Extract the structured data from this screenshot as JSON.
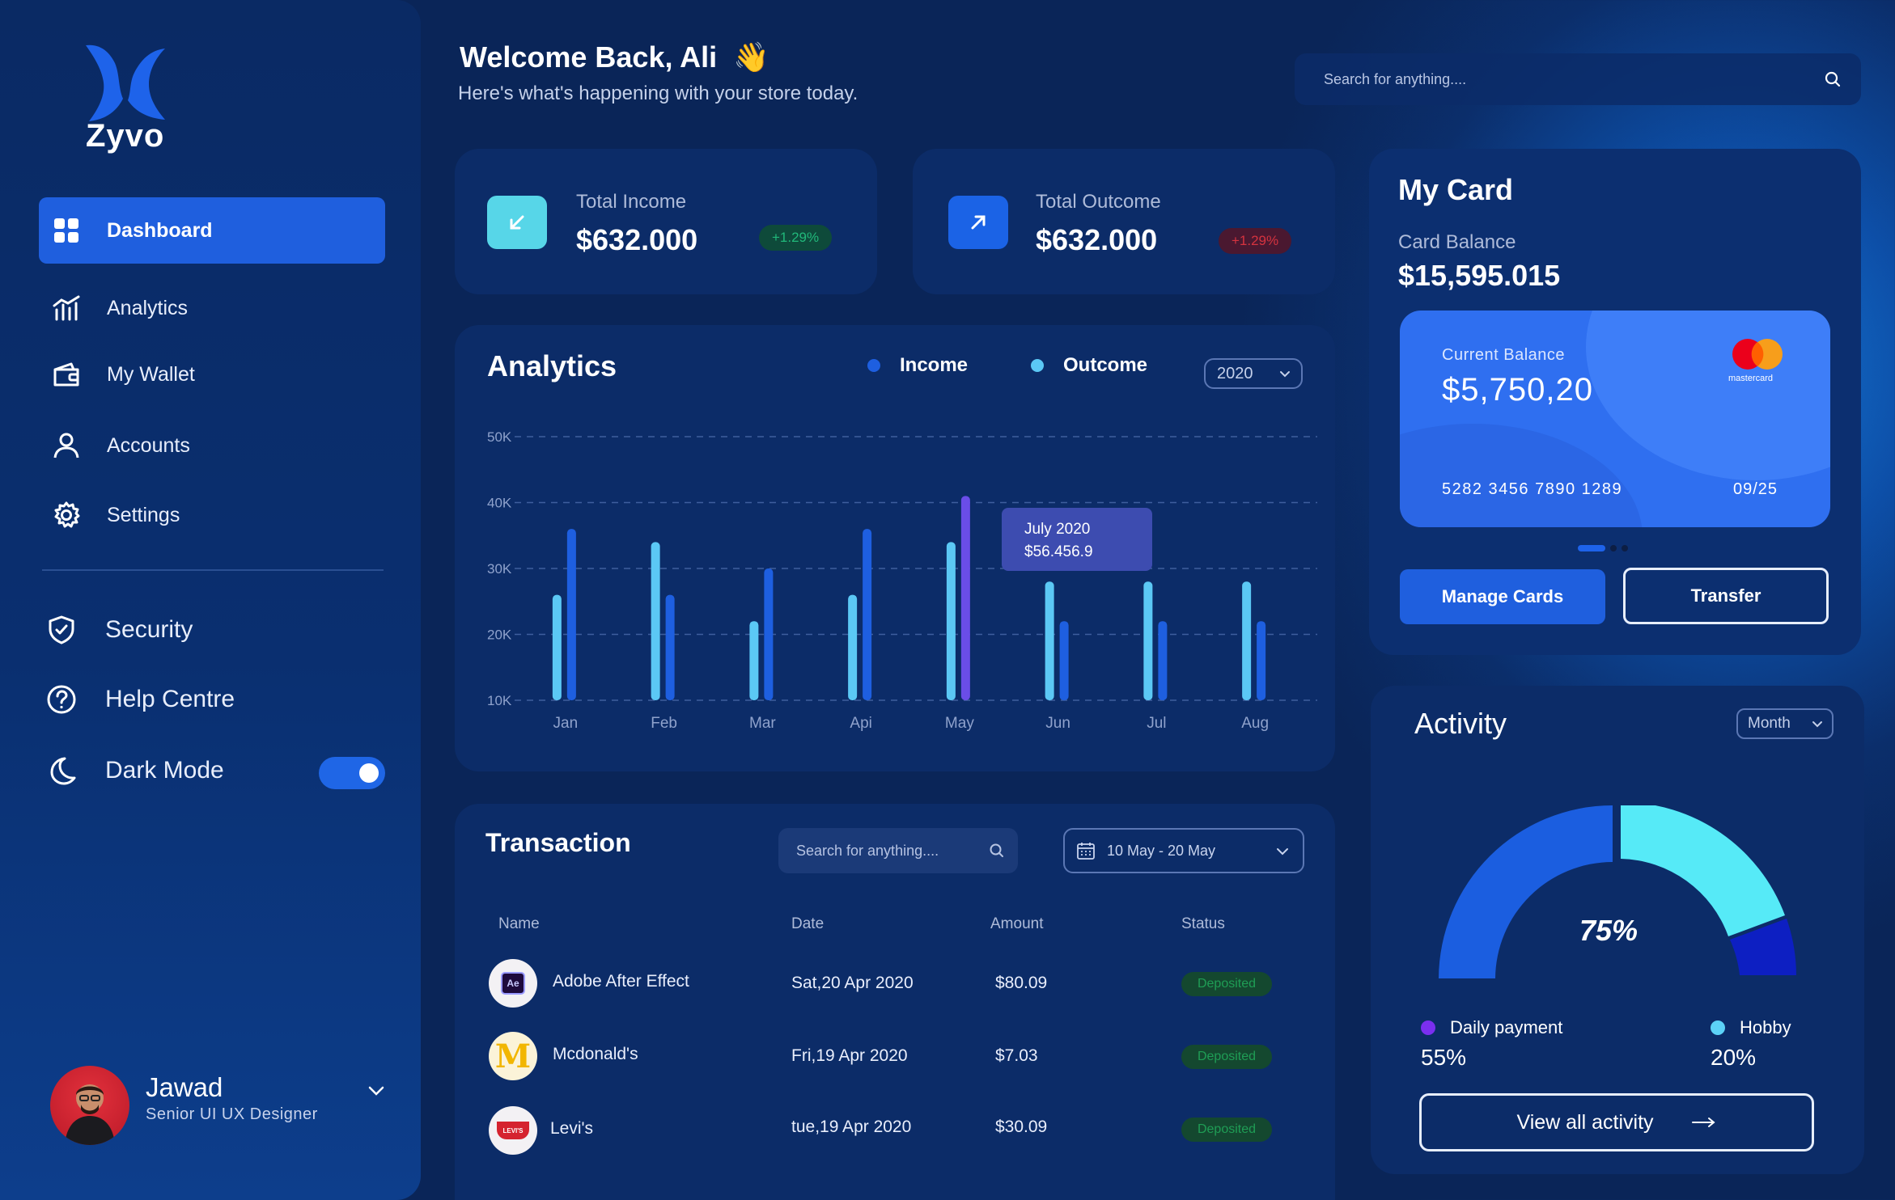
{
  "app": {
    "name": "Zyvo"
  },
  "sidebar": {
    "items": [
      {
        "label": "Dashboard",
        "icon": "grid-icon"
      },
      {
        "label": "Analytics",
        "icon": "chart-icon"
      },
      {
        "label": "My Wallet",
        "icon": "wallet-icon"
      },
      {
        "label": "Accounts",
        "icon": "user-icon"
      },
      {
        "label": "Settings",
        "icon": "gear-icon"
      },
      {
        "label": "Security",
        "icon": "shield-icon"
      },
      {
        "label": "Help Centre",
        "icon": "help-icon"
      },
      {
        "label": "Dark Mode",
        "icon": "moon-icon"
      }
    ],
    "dark_mode_on": true,
    "profile": {
      "name": "Jawad",
      "role": "Senior UI UX Designer"
    }
  },
  "header": {
    "welcome": "Welcome Back, Ali",
    "welcome_emoji": "👋",
    "subtitle": "Here's what's happening with your store today.",
    "search_placeholder": "Search for anything...."
  },
  "stats": {
    "income": {
      "label": "Total Income",
      "value": "$632.000",
      "change": "+1.29%"
    },
    "outcome": {
      "label": "Total Outcome",
      "value": "$632.000",
      "change": "+1.29%"
    }
  },
  "analytics": {
    "title": "Analytics",
    "legend_income": "Income",
    "legend_outcome": "Outcome",
    "year": "2020",
    "tooltip_title": "July 2020",
    "tooltip_value": "$56.456.9"
  },
  "chart_data": {
    "type": "bar",
    "categories": [
      "Jan",
      "Feb",
      "Mar",
      "Api",
      "May",
      "Jun",
      "Jul",
      "Aug"
    ],
    "series": [
      {
        "name": "Outcome",
        "values": [
          26,
          34,
          22,
          26,
          34,
          28,
          28,
          28
        ]
      },
      {
        "name": "Income",
        "values": [
          36,
          26,
          30,
          36,
          41,
          22,
          22,
          22
        ]
      }
    ],
    "yticks": [
      "10K",
      "20K",
      "30K",
      "40K",
      "50K"
    ],
    "ylim": [
      10,
      50
    ],
    "grid": true,
    "highlight_category": "May",
    "highlight_color": "#6a4de8",
    "colors": {
      "Income": "#1e5fe0",
      "Outcome": "#5bc8f5"
    }
  },
  "transactions": {
    "title": "Transaction",
    "search_placeholder": "Search for anything....",
    "date_range": "10 May - 20 May",
    "headers": {
      "name": "Name",
      "date": "Date",
      "amount": "Amount",
      "status": "Status"
    },
    "rows": [
      {
        "name": "Adobe After Effect",
        "date": "Sat,20 Apr 2020",
        "amount": "$80.09",
        "status": "Deposited",
        "logo": "Ae"
      },
      {
        "name": "Mcdonald's",
        "date": "Fri,19 Apr 2020",
        "amount": "$7.03",
        "status": "Deposited",
        "logo": "M"
      },
      {
        "name": "Levi's",
        "date": "tue,19 Apr 2020",
        "amount": "$30.09",
        "status": "Deposited",
        "logo": "LEVI'S"
      }
    ]
  },
  "my_card": {
    "title": "My Card",
    "balance_label": "Card Balance",
    "balance": "$15,595.015",
    "card": {
      "current_label": "Current Balance",
      "current_value": "$5,750,20",
      "number": "5282 3456 7890 1289",
      "expiry": "09/25",
      "brand": "mastercard"
    },
    "manage_label": "Manage Cards",
    "transfer_label": "Transfer"
  },
  "activity": {
    "title": "Activity",
    "period": "Month",
    "gauge_value": "75%",
    "gauge_fraction": 0.75,
    "daily_label": "Daily payment",
    "daily_pct": "55%",
    "hobby_label": "Hobby",
    "hobby_pct": "20%",
    "view_all": "View all activity"
  }
}
